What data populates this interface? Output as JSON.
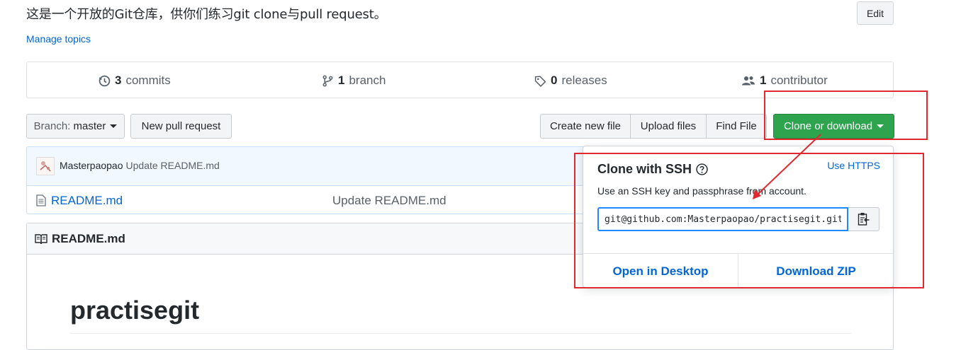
{
  "repo": {
    "description": "这是一个开放的Git仓库，供你们练习git clone与pull request。",
    "manage_topics": "Manage topics",
    "edit_label": "Edit"
  },
  "summary": {
    "commits_count": "3",
    "commits_label": "commits",
    "branch_count": "1",
    "branch_label": "branch",
    "releases_count": "0",
    "releases_label": "releases",
    "contributor_count": "1",
    "contributor_label": "contributor"
  },
  "toolbar": {
    "branch_prefix": "Branch:",
    "branch_name": "master",
    "new_pr": "New pull request",
    "create_file": "Create new file",
    "upload_files": "Upload files",
    "find_file": "Find File",
    "clone_download": "Clone or download"
  },
  "commit": {
    "author": "Masterpaopao",
    "message": "Update README.md"
  },
  "files": [
    {
      "name": "README.md",
      "message": "Update README.md"
    }
  ],
  "readme": {
    "title": "README.md",
    "heading": "practisegit"
  },
  "clone_dropdown": {
    "title": "Clone with SSH",
    "use_https": "Use HTTPS",
    "subtitle": "Use an SSH key and passphrase from account.",
    "url": "git@github.com:Masterpaopao/practisegit.git",
    "open_desktop": "Open in Desktop",
    "download_zip": "Download ZIP"
  },
  "colors": {
    "link": "#0366d6",
    "clone_green": "#2ea44f",
    "annotation_red": "#e0282e"
  }
}
